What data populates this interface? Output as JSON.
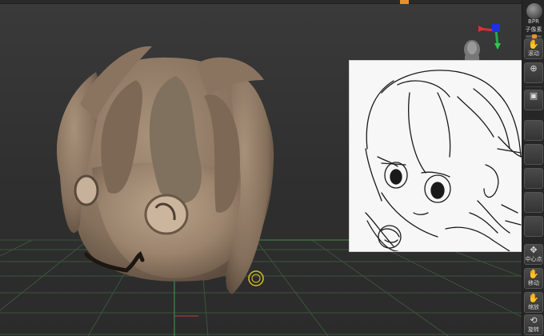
{
  "app": {
    "accent_color": "#e9902a",
    "sculpt_color": "#a08a74",
    "grid_color": "#3f5a3f"
  },
  "toolbar": {
    "buttons": [
      {
        "icon": "sphere-material-icon",
        "glyph": "●",
        "label": "BPR"
      },
      {
        "icon": "subtool-slider-icon",
        "glyph": "",
        "label": "子像素"
      },
      {
        "icon": "hand-move-icon",
        "glyph": "✋",
        "label": "滚动"
      },
      {
        "icon": "zoom-icon",
        "glyph": "⊕",
        "label": ""
      },
      {
        "icon": "frame-icon",
        "glyph": "▣",
        "label": ""
      },
      {
        "icon": "center-icon",
        "glyph": "✥",
        "label": "中心点"
      },
      {
        "icon": "move-icon",
        "glyph": "✋",
        "label": "移动"
      },
      {
        "icon": "scale-icon",
        "glyph": "✋",
        "label": "缩放"
      },
      {
        "icon": "rotate-icon",
        "glyph": "⟲",
        "label": "旋转"
      }
    ]
  }
}
